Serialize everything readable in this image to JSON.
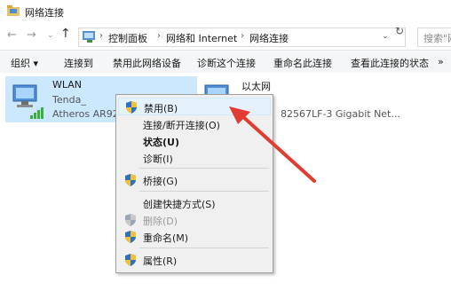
{
  "window": {
    "title": "网络连接"
  },
  "address": {
    "crumbs": [
      "控制面板",
      "网络和 Internet",
      "网络连接"
    ],
    "search_placeholder": "搜索\"网"
  },
  "nav": {
    "back": "←",
    "forward": "→",
    "recent": "⌄",
    "up": "↑",
    "dropdown": "⌄",
    "refresh": "↻"
  },
  "commands": [
    "组织 ▾",
    "连接到",
    "禁用此网络设备",
    "诊断这个连接",
    "重命名此连接",
    "查看此连接的状态",
    "»"
  ],
  "connections": {
    "wlan": {
      "name": "WLAN",
      "ssid": "Tenda_",
      "adapter": "Atheros AR927"
    },
    "ethernet": {
      "name": "以太网",
      "status": "1",
      "adapter": "82567LF-3 Gigabit Net..."
    }
  },
  "context_menu": {
    "items": [
      {
        "label": "禁用(B)",
        "shield": true,
        "highlighted": true
      },
      {
        "label": "连接/断开连接(O)"
      },
      {
        "label": "状态(U)",
        "bold": true
      },
      {
        "label": "诊断(I)"
      },
      {
        "label": "桥接(G)",
        "shield": true
      },
      {
        "label": "创建快捷方式(S)"
      },
      {
        "label": "删除(D)",
        "shield": true,
        "disabled": true
      },
      {
        "label": "重命名(M)",
        "shield": true
      },
      {
        "label": "属性(R)",
        "shield": true
      }
    ]
  },
  "colors": {
    "selection": "#cce8ff",
    "arrow": "#e03c31",
    "menu_bg": "#f0f0f0"
  }
}
